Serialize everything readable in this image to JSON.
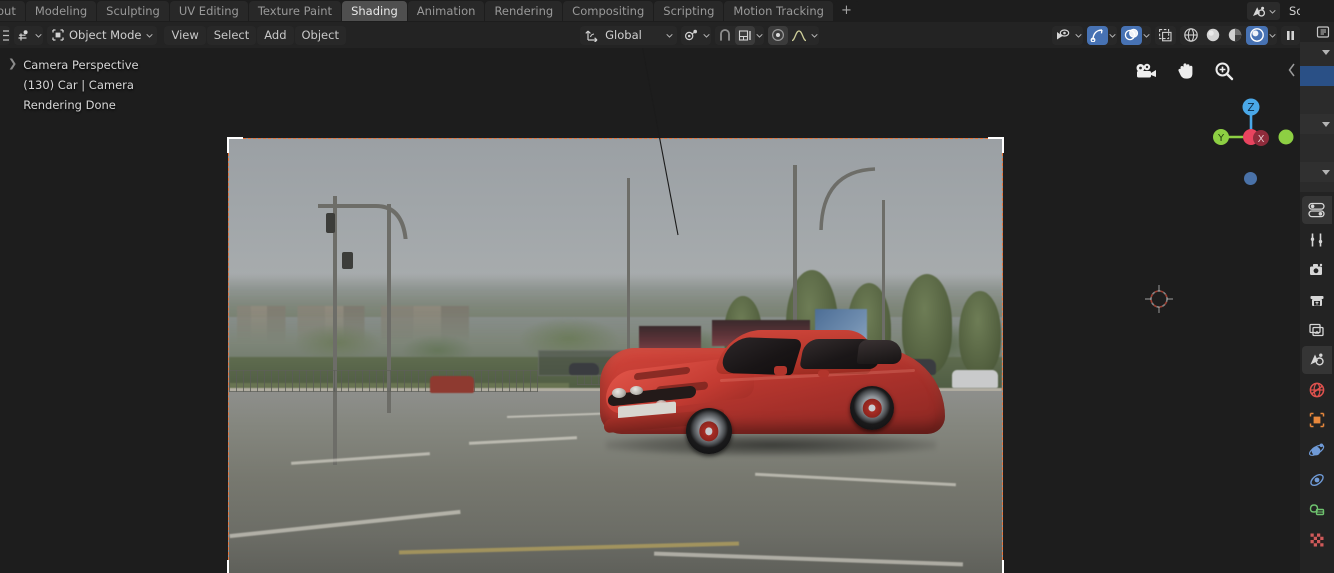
{
  "app": {
    "name": "Blender",
    "accent_blue": "#4772b3",
    "camera_border": "#e8743a",
    "editor_bg": "#1d1d1d",
    "header_bg": "#232323"
  },
  "topbar": {
    "workspace_tabs": [
      {
        "label": "out",
        "name": "layout",
        "active": false
      },
      {
        "label": "Modeling",
        "name": "modeling",
        "active": false
      },
      {
        "label": "Sculpting",
        "name": "sculpting",
        "active": false
      },
      {
        "label": "UV Editing",
        "name": "uv-editing",
        "active": false
      },
      {
        "label": "Texture Paint",
        "name": "texture-paint",
        "active": false
      },
      {
        "label": "Shading",
        "name": "shading",
        "active": true
      },
      {
        "label": "Animation",
        "name": "animation",
        "active": false
      },
      {
        "label": "Rendering",
        "name": "rendering",
        "active": false
      },
      {
        "label": "Compositing",
        "name": "compositing",
        "active": false
      },
      {
        "label": "Scripting",
        "name": "scripting",
        "active": false
      },
      {
        "label": "Motion Tracking",
        "name": "motion-tracking",
        "active": false
      }
    ],
    "add_workspace_label": "+",
    "scene": {
      "browse_icon": "scene-browse-icon",
      "name": "Scene"
    }
  },
  "viewport_header": {
    "editor_type_icon": "editor-type-icon",
    "mode_icon": "object-mode-icon",
    "mode_label": "Object Mode",
    "menus": [
      {
        "label": "View",
        "name": "view-menu"
      },
      {
        "label": "Select",
        "name": "select-menu"
      },
      {
        "label": "Add",
        "name": "add-menu"
      },
      {
        "label": "Object",
        "name": "object-menu"
      }
    ],
    "transform_orientation": {
      "icon": "orientation-axis-icon",
      "label": "Global"
    },
    "pivot_icon": "pivot-point-icon",
    "snap_icon": "snap-magnet-icon",
    "snap_target_icon": "snap-increment-icon",
    "proportional_icon": "proportional-editing-icon",
    "falloff_icon": "falloff-curve-icon",
    "visibility_icon": "object-visibility-icon",
    "gizmo_icon": "gizmo-icon",
    "gizmo_active": true,
    "overlays_icon": "overlays-icon",
    "overlays_active": true,
    "xray_icon": "xray-toggle-icon",
    "shading_modes": [
      {
        "name": "wireframe",
        "icon": "shading-wireframe-icon",
        "active": false
      },
      {
        "name": "solid",
        "icon": "shading-solid-icon",
        "active": false
      },
      {
        "name": "material-preview",
        "icon": "shading-material-icon",
        "active": false
      },
      {
        "name": "rendered",
        "icon": "shading-rendered-icon",
        "active": true
      }
    ],
    "pause_icon": "pause-render-icon"
  },
  "viewport": {
    "info_expand_icon": "expand-arrow-icon",
    "info_lines": [
      "Camera Perspective",
      "(130) Car | Camera",
      "Rendering Done"
    ],
    "nav_icons": [
      {
        "name": "camera-view-icon"
      },
      {
        "name": "move-view-hand-icon"
      },
      {
        "name": "zoom-view-icon"
      }
    ],
    "axis_gizmo": {
      "z_label": "Z",
      "y_label": "Y",
      "x_label": "X",
      "z_color": "#4aa8e8",
      "y_color": "#8dcf43",
      "x_color": "#e8445f"
    },
    "perspective_dot_name": "perspective-toggle-dot",
    "sidebar_toggle_icon": "sidebar-collapse-arrow-icon",
    "cursor_3d_name": "3d-cursor",
    "render_region": {
      "name": "camera-render-border",
      "corner_marker_name": "camera-corner-marker"
    },
    "rendered_subject": "red sports car composited on a roadside photographic background plate"
  },
  "outliner": {
    "header_icon": "outliner-filter-icon",
    "rows": [
      {
        "name": "outliner-row-1",
        "selected": false,
        "has_disclosure": true
      },
      {
        "name": "outliner-row-2",
        "selected": true,
        "has_disclosure": false
      },
      {
        "name": "outliner-row-3",
        "selected": false,
        "has_disclosure": false
      },
      {
        "name": "outliner-row-4",
        "selected": false,
        "has_disclosure": true
      },
      {
        "name": "outliner-row-5",
        "selected": false,
        "has_disclosure": false
      },
      {
        "name": "outliner-row-6",
        "selected": false,
        "has_disclosure": true
      }
    ]
  },
  "properties": {
    "tabs": [
      {
        "name": "tool-properties-tab",
        "icon": "tool-wrench-icon",
        "color": "#d6d6d6",
        "active": false
      },
      {
        "name": "render-properties-tab",
        "icon": "render-camera-icon",
        "color": "#d6d6d6",
        "active": false
      },
      {
        "name": "output-properties-tab",
        "icon": "output-printer-icon",
        "color": "#d6d6d6",
        "active": false
      },
      {
        "name": "view-layer-properties-tab",
        "icon": "view-layer-images-icon",
        "color": "#d6d6d6",
        "active": false
      },
      {
        "name": "scene-properties-tab",
        "icon": "scene-cone-icon",
        "color": "#d6d6d6",
        "active": true
      },
      {
        "name": "world-properties-tab",
        "icon": "world-globe-icon",
        "color": "#e0524e",
        "active": false
      },
      {
        "name": "object-properties-tab",
        "icon": "object-square-icon",
        "color": "#e8883c",
        "active": false
      },
      {
        "name": "modifier-properties-tab",
        "icon": "physics-orbit-icon",
        "color": "#6f9ad6",
        "active": false
      },
      {
        "name": "particle-properties-tab",
        "icon": "particles-icon",
        "color": "#6f9ad6",
        "active": false
      },
      {
        "name": "constraint-properties-tab",
        "icon": "constraint-clamp-icon",
        "color": "#6ec26e",
        "active": false
      },
      {
        "name": "texture-properties-tab",
        "icon": "texture-checker-icon",
        "color": "#d05a5a",
        "active": false
      }
    ],
    "settings_icon": "properties-settings-icon"
  }
}
